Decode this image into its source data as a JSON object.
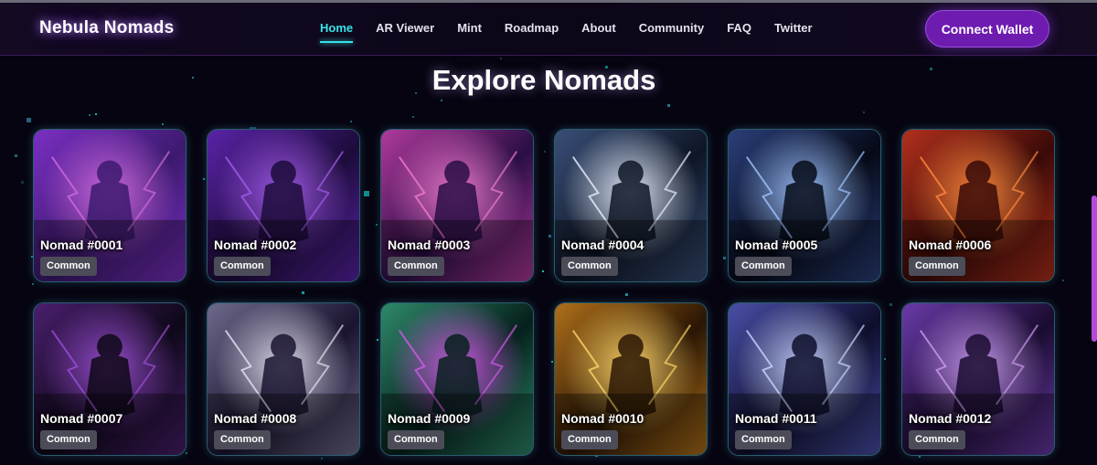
{
  "header": {
    "brand": "Nebula Nomads",
    "nav": [
      {
        "label": "Home",
        "active": true
      },
      {
        "label": "AR Viewer",
        "active": false
      },
      {
        "label": "Mint",
        "active": false
      },
      {
        "label": "Roadmap",
        "active": false
      },
      {
        "label": "About",
        "active": false
      },
      {
        "label": "Community",
        "active": false
      },
      {
        "label": "FAQ",
        "active": false
      },
      {
        "label": "Twitter",
        "active": false
      }
    ],
    "connect_label": "Connect Wallet"
  },
  "main": {
    "title": "Explore Nomads",
    "nomads": [
      {
        "name": "Nomad #0001",
        "rarity": "Common",
        "palette": [
          "#3c1a6e",
          "#7b2fc4",
          "#d06ae0"
        ]
      },
      {
        "name": "Nomad #0002",
        "rarity": "Common",
        "palette": [
          "#1c0c3a",
          "#5a23a8",
          "#a45bea"
        ]
      },
      {
        "name": "Nomad #0003",
        "rarity": "Common",
        "palette": [
          "#2a0e45",
          "#b03a9c",
          "#f07ad0"
        ]
      },
      {
        "name": "Nomad #0004",
        "rarity": "Common",
        "palette": [
          "#0e1626",
          "#3a4f78",
          "#e8f0ff"
        ]
      },
      {
        "name": "Nomad #0005",
        "rarity": "Common",
        "palette": [
          "#060a18",
          "#2b3f7a",
          "#9fc4ff"
        ]
      },
      {
        "name": "Nomad #0006",
        "rarity": "Common",
        "palette": [
          "#3a0a08",
          "#b2301c",
          "#ff8a3c"
        ]
      },
      {
        "name": "Nomad #0007",
        "rarity": "Common",
        "palette": [
          "#0e0818",
          "#4a1f6e",
          "#9c4fd6"
        ]
      },
      {
        "name": "Nomad #0008",
        "rarity": "Common",
        "palette": [
          "#1a1430",
          "#6e6a8c",
          "#e6e2f2"
        ]
      },
      {
        "name": "Nomad #0009",
        "rarity": "Common",
        "palette": [
          "#06201c",
          "#2e8a6a",
          "#d25ae8"
        ]
      },
      {
        "name": "Nomad #0010",
        "rarity": "Common",
        "palette": [
          "#2a1604",
          "#b0701a",
          "#ffd76a"
        ]
      },
      {
        "name": "Nomad #0011",
        "rarity": "Common",
        "palette": [
          "#0e0e2c",
          "#4a4fa8",
          "#c8d4ff"
        ]
      },
      {
        "name": "Nomad #0012",
        "rarity": "Common",
        "palette": [
          "#1a0c30",
          "#6a3aa8",
          "#c99af0"
        ]
      }
    ]
  }
}
